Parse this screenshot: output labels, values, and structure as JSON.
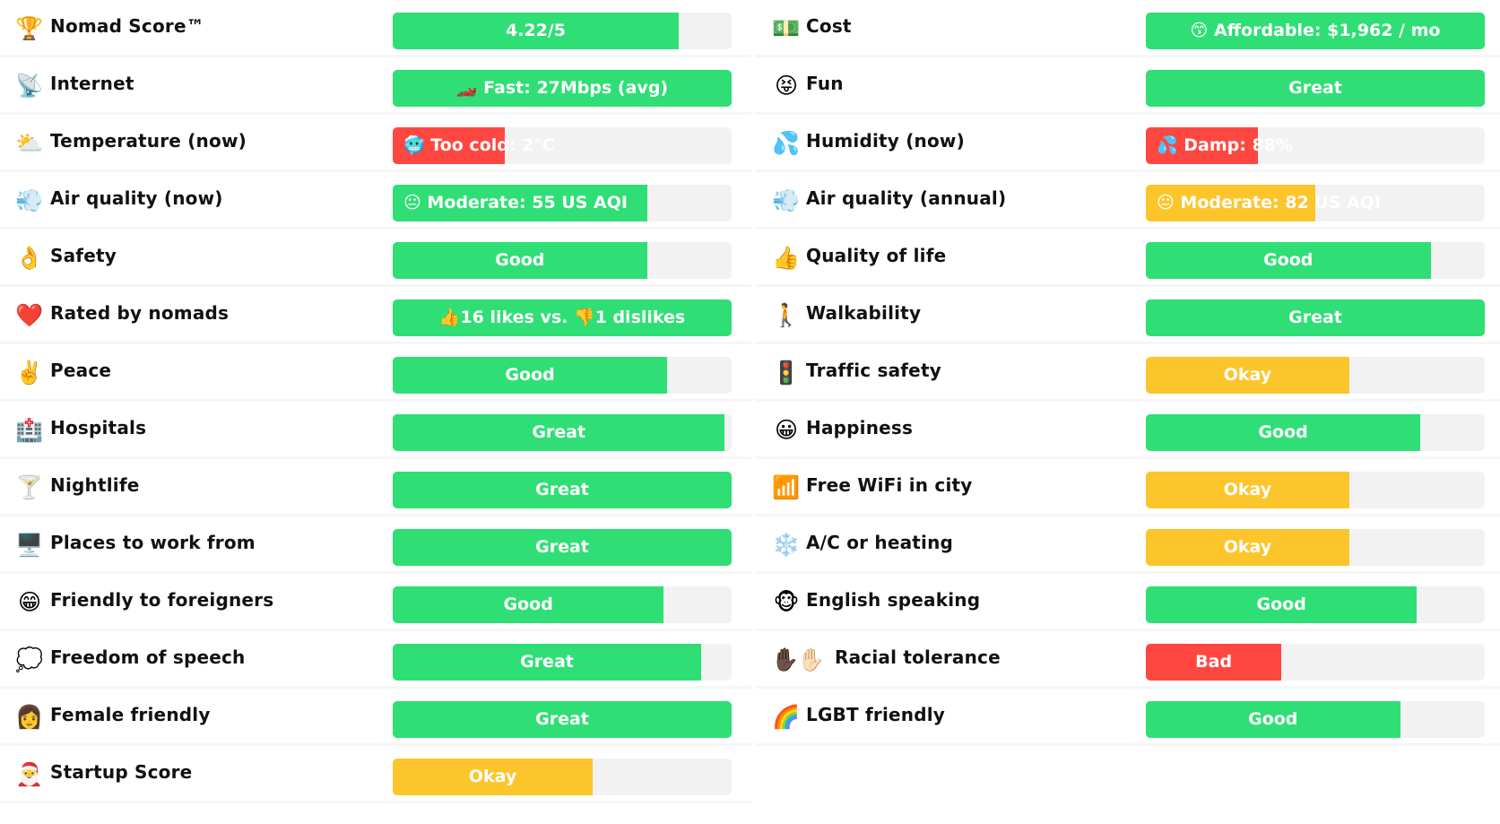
{
  "colors": {
    "great": "#2fdf75",
    "bad": "#ff4742",
    "okay": "#fdc52c",
    "track": "#f2f2f2"
  },
  "left": [
    {
      "icon": "🏆",
      "icon_name": "trophy-icon",
      "label": "Nomad Score™",
      "value": "4.22/5",
      "fill": 0.844,
      "color": "green"
    },
    {
      "icon": "📡",
      "icon_name": "satellite-dish-icon",
      "label": "Internet",
      "value": "🏎️ Fast: 27Mbps (avg)",
      "fill": 1.0,
      "color": "green"
    },
    {
      "icon": "⛅",
      "icon_name": "sun-behind-cloud-icon",
      "label": "Temperature (now)",
      "value": "🥶 Too cold: 2°C",
      "fill": 0.33,
      "color": "red",
      "align": "left"
    },
    {
      "icon": "💨",
      "icon_name": "wind-icon",
      "label": "Air quality (now)",
      "value": "😐 Moderate: 55 US AQI",
      "fill": 0.75,
      "color": "green",
      "align": "left"
    },
    {
      "icon": "👌",
      "icon_name": "ok-hand-icon",
      "label": "Safety",
      "value": "Good",
      "fill": 0.75,
      "color": "green"
    },
    {
      "icon": "❤️",
      "icon_name": "heart-icon",
      "label": "Rated by nomads",
      "value": "👍16 likes vs. 👎1 dislikes",
      "fill": 1.0,
      "color": "green"
    },
    {
      "icon": "✌️",
      "icon_name": "victory-hand-icon",
      "label": "Peace",
      "value": "Good",
      "fill": 0.81,
      "color": "green"
    },
    {
      "icon": "🏥",
      "icon_name": "hospital-icon",
      "label": "Hospitals",
      "value": "Great",
      "fill": 0.98,
      "color": "green"
    },
    {
      "icon": "🍸",
      "icon_name": "cocktail-icon",
      "label": "Nightlife",
      "value": "Great",
      "fill": 1.0,
      "color": "green"
    },
    {
      "icon": "🖥️",
      "icon_name": "desktop-computer-icon",
      "label": "Places to work from",
      "value": "Great",
      "fill": 1.0,
      "color": "green"
    },
    {
      "icon": "😁",
      "icon_name": "grinning-face-icon",
      "label": "Friendly to foreigners",
      "value": "Good",
      "fill": 0.8,
      "color": "green"
    },
    {
      "icon": "💭",
      "icon_name": "speech-bubble-icon",
      "label": "Freedom of speech",
      "value": "Great",
      "fill": 0.91,
      "color": "green"
    },
    {
      "icon": "👩",
      "icon_name": "woman-icon",
      "label": "Female friendly",
      "value": "Great",
      "fill": 1.0,
      "color": "green"
    },
    {
      "icon": "🎅",
      "icon_name": "santa-icon",
      "label": "Startup Score",
      "value": "Okay",
      "fill": 0.59,
      "color": "yellow"
    }
  ],
  "right": [
    {
      "icon": "💵",
      "icon_name": "money-icon",
      "label": "Cost",
      "value": "😙 Affordable: $1,962 / mo",
      "fill": 1.0,
      "color": "green"
    },
    {
      "icon": "😝",
      "icon_name": "tongue-face-icon",
      "label": "Fun",
      "value": "Great",
      "fill": 1.0,
      "color": "green"
    },
    {
      "icon": "💦",
      "icon_name": "sweat-droplets-icon",
      "label": "Humidity (now)",
      "value": "💦 Damp: 88%",
      "fill": 0.33,
      "color": "red",
      "align": "left"
    },
    {
      "icon": "💨",
      "icon_name": "wind-icon",
      "label": "Air quality (annual)",
      "value": "😐 Moderate: 82 US AQI",
      "fill": 0.5,
      "color": "yellow",
      "align": "left"
    },
    {
      "icon": "👍",
      "icon_name": "thumbs-up-icon",
      "label": "Quality of life",
      "value": "Good",
      "fill": 0.84,
      "color": "green"
    },
    {
      "icon": "🚶",
      "icon_name": "walking-person-icon",
      "label": "Walkability",
      "value": "Great",
      "fill": 1.0,
      "color": "green"
    },
    {
      "icon": "🚦",
      "icon_name": "traffic-light-icon",
      "label": "Traffic safety",
      "value": "Okay",
      "fill": 0.6,
      "color": "yellow"
    },
    {
      "icon": "😀",
      "icon_name": "happy-face-icon",
      "label": "Happiness",
      "value": "Good",
      "fill": 0.81,
      "color": "green"
    },
    {
      "icon": "📶",
      "icon_name": "signal-bars-icon",
      "label": "Free WiFi in city",
      "value": "Okay",
      "fill": 0.6,
      "color": "yellow"
    },
    {
      "icon": "❄️",
      "icon_name": "snowflake-icon",
      "label": "A/C or heating",
      "value": "Okay",
      "fill": 0.6,
      "color": "yellow"
    },
    {
      "icon": "🐵",
      "icon_name": "monkey-face-icon",
      "label": "English speaking",
      "value": "Good",
      "fill": 0.8,
      "color": "green"
    },
    {
      "icon": "✋🏿✋🏻",
      "icon_name": "raised-hands-icon",
      "label": "Racial tolerance",
      "value": "Bad",
      "fill": 0.4,
      "color": "red",
      "wide": true
    },
    {
      "icon": "🌈",
      "icon_name": "rainbow-icon",
      "label": "LGBT friendly",
      "value": "Good",
      "fill": 0.75,
      "color": "green"
    }
  ]
}
